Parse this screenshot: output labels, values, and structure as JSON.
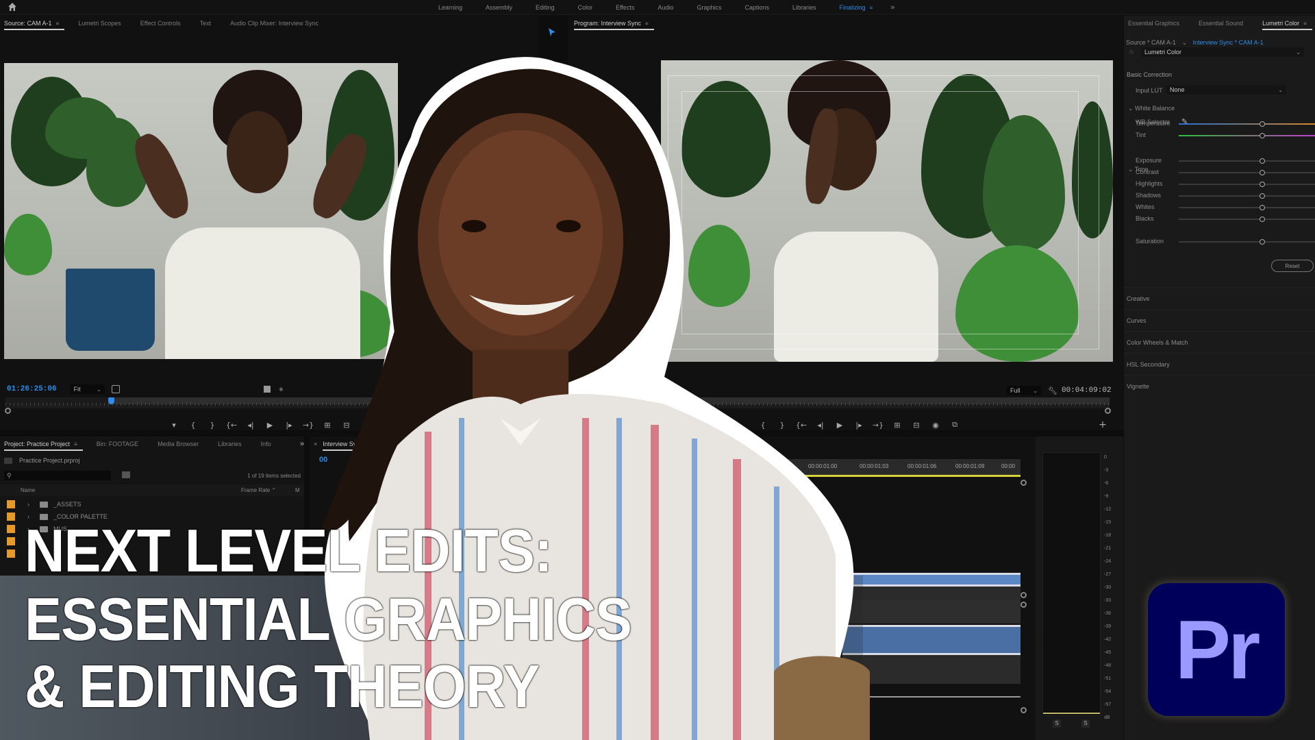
{
  "topbar": {
    "workspaces": [
      "Learning",
      "Assembly",
      "Editing",
      "Color",
      "Effects",
      "Audio",
      "Graphics",
      "Captions",
      "Libraries",
      "Finalizing"
    ],
    "active_workspace": "Finalizing",
    "overflow": "»",
    "menu_glyph": "≡"
  },
  "source_panel": {
    "tabs": [
      "Source: CAM A-1",
      "Lumetri Scopes",
      "Effect Controls",
      "Text",
      "Audio Clip Mixer: Interview Sync"
    ],
    "timecode": "01:26:25:06",
    "zoom": "Fit",
    "transport": [
      "▾",
      "{",
      "}",
      "{←",
      "◂|",
      "▶",
      "|▸",
      "→}",
      "⊞",
      "⊟"
    ]
  },
  "program_panel": {
    "title": "Program: Interview Sync",
    "resolution": "Full",
    "timecode": "00:04:09:02",
    "transport": [
      "{",
      "}",
      "{←",
      "◂|",
      "▶",
      "|▸",
      "→}",
      "⊞",
      "⊟",
      "◉",
      "⧉"
    ],
    "add": "+"
  },
  "lumetri": {
    "tabs": [
      "Essential Graphics",
      "Essential Sound",
      "Lumetri Color"
    ],
    "source_label": "Source * CAM A-1",
    "sequence_label": "Interview Sync * CAM A-1",
    "fx_label": "fx",
    "effect": "Lumetri Color",
    "basic_correction": "Basic Correction",
    "input_lut_label": "Input LUT",
    "input_lut_value": "None",
    "white_balance": "White Balance",
    "wb_selector": "WB Selector",
    "tone": "Tone",
    "sliders": [
      {
        "label": "Temperature",
        "value": 0.0
      },
      {
        "label": "Tint",
        "value": 0.0
      },
      {
        "label": "Exposure",
        "value": 0.0
      },
      {
        "label": "Contrast",
        "value": 0.0
      },
      {
        "label": "Highlights",
        "value": 0.0
      },
      {
        "label": "Shadows",
        "value": 0.0
      },
      {
        "label": "Whites",
        "value": 0.0
      },
      {
        "label": "Blacks",
        "value": 0.0
      },
      {
        "label": "Saturation",
        "value": 100.0
      }
    ],
    "reset": "Reset",
    "sections": [
      "Creative",
      "Curves",
      "Color Wheels & Match",
      "HSL Secondary",
      "Vignette"
    ]
  },
  "project_panel": {
    "tabs": [
      "Project: Practice Project",
      "Bin: FOOTAGE",
      "Media Browser",
      "Libraries",
      "Info"
    ],
    "overflow": "»",
    "project_file": "Practice Project.prproj",
    "search_placeholder": "",
    "selection_status": "1 of 19 items selected",
    "columns": [
      "Name",
      "Frame Rate",
      "M"
    ],
    "items": [
      "_ASSETS",
      "_COLOR PALETTE",
      "MUS",
      "",
      ""
    ]
  },
  "timeline_panel": {
    "tab": "Interview Sync",
    "close": "×",
    "timecode_partial": "00",
    "ruler": [
      "00:00:01:00",
      "00:00:01:03",
      "00:00:01:06",
      "00:00:01:09",
      "00:00"
    ]
  },
  "audio_meter": {
    "scale": [
      "0",
      "-3",
      "-6",
      "-9",
      "-12",
      "-15",
      "-18",
      "-21",
      "-24",
      "-27",
      "-30",
      "-33",
      "-36",
      "-39",
      "-42",
      "-45",
      "-48",
      "-51",
      "-54",
      "-57",
      "dB"
    ],
    "solo": [
      "S",
      "S"
    ]
  },
  "thumbnail": {
    "headline": [
      "NEXT LEVEL EDITS:",
      "ESSENTIAL GRAPHICS",
      "& EDITING THEORY"
    ],
    "logo_text": "Pr",
    "logo_bg": "#00005b",
    "logo_fg": "#9999ff"
  },
  "colors": {
    "accent": "#2d8ceb",
    "work_area": "#d9d33a",
    "label_orange": "#e69a2c",
    "clip_blue": "#5b87c4"
  }
}
